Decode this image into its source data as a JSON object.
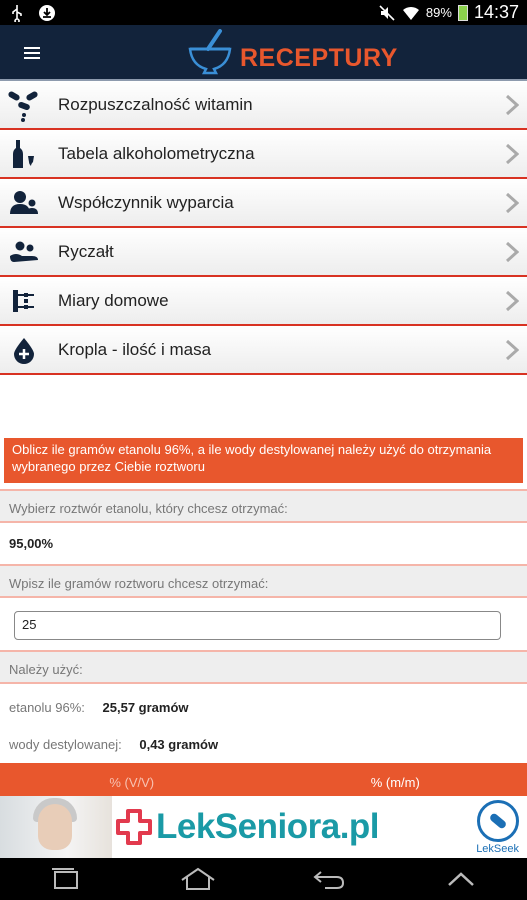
{
  "status_bar": {
    "battery": "89%",
    "time": "14:37"
  },
  "header": {
    "title": "RECEPTURY",
    "colors": {
      "background": "#12233b",
      "accent": "#e8572d"
    }
  },
  "menu": {
    "items": [
      {
        "label": "Rozpuszczalność witamin",
        "icon": "vitamin-icon"
      },
      {
        "label": "Tabela alkoholometryczna",
        "icon": "bottle-icon"
      },
      {
        "label": "Współczynnik wyparcia",
        "icon": "users-icon"
      },
      {
        "label": "Ryczałt",
        "icon": "hand-icon"
      },
      {
        "label": "Miary domowe",
        "icon": "measure-icon"
      },
      {
        "label": "Kropla - ilość i masa",
        "icon": "drop-icon"
      }
    ]
  },
  "calculator": {
    "info": "Oblicz ile gramów etanolu 96%, a ile wody destylowanej należy użyć do otrzymania wybranego przez Ciebie roztworu",
    "solution_label": "Wybierz roztwór etanolu, który chcesz otrzymać:",
    "solution_value": "95,00%",
    "grams_label": "Wpisz ile gramów roztworu chcesz otrzymać:",
    "grams_value": "25",
    "result_label": "Należy użyć:",
    "ethanol_label": "etanolu 96%:",
    "ethanol_value": "25,57 gramów",
    "water_label": "wody destylowanej:",
    "water_value": "0,43 gramów"
  },
  "tabs": [
    {
      "label": "% (V/V)",
      "active": false
    },
    {
      "label": "% (m/m)",
      "active": true
    }
  ],
  "ad": {
    "brand_main": "LekSeniora",
    "brand_suffix": ".pl",
    "badge_text": "LekSeek"
  }
}
